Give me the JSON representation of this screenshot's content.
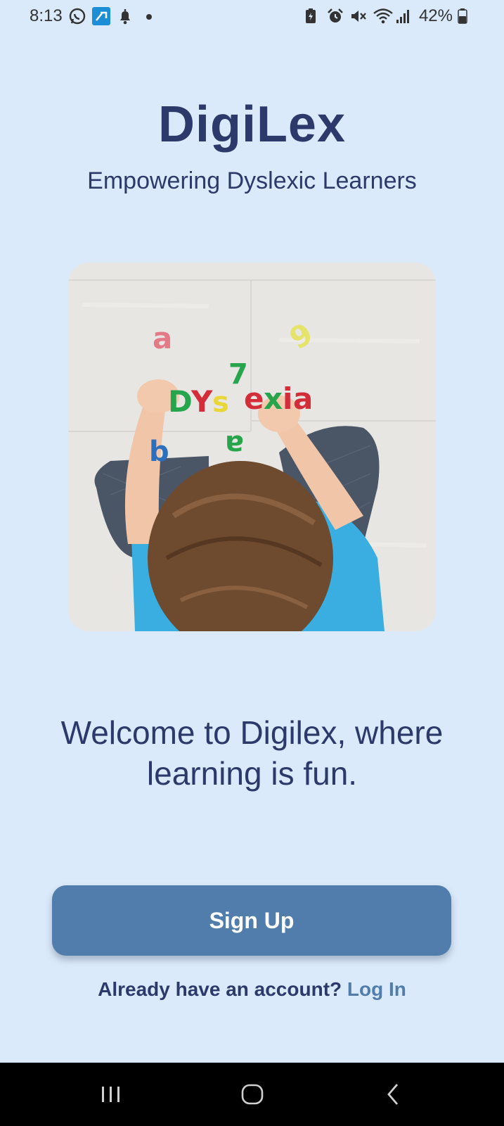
{
  "status_bar": {
    "time": "8:13",
    "battery": "42%",
    "left_icons": [
      "whatsapp-icon",
      "app-notification-icon",
      "bell-icon",
      "dot-icon"
    ],
    "right_icons": [
      "battery-saver-icon",
      "alarm-icon",
      "mute-icon",
      "wifi-icon",
      "signal-icon",
      "battery-icon"
    ]
  },
  "header": {
    "title": "DigiLex",
    "subtitle": "Empowering Dyslexic Learners"
  },
  "hero": {
    "letters": [
      "a",
      "9",
      "7",
      "D",
      "Y",
      "s",
      "e",
      "x",
      "i",
      "a",
      "b",
      "a"
    ]
  },
  "welcome": {
    "text": "Welcome to Digilex, where learning is fun."
  },
  "actions": {
    "signup_label": "Sign Up",
    "login_prompt": "Already have an account?",
    "login_label": "Log In"
  },
  "colors": {
    "background": "#dbeafa",
    "title": "#2b3a6b",
    "button": "#517dad",
    "link": "#517dad"
  },
  "nav_bar": {
    "buttons": [
      "recents-icon",
      "home-icon",
      "back-icon"
    ]
  }
}
